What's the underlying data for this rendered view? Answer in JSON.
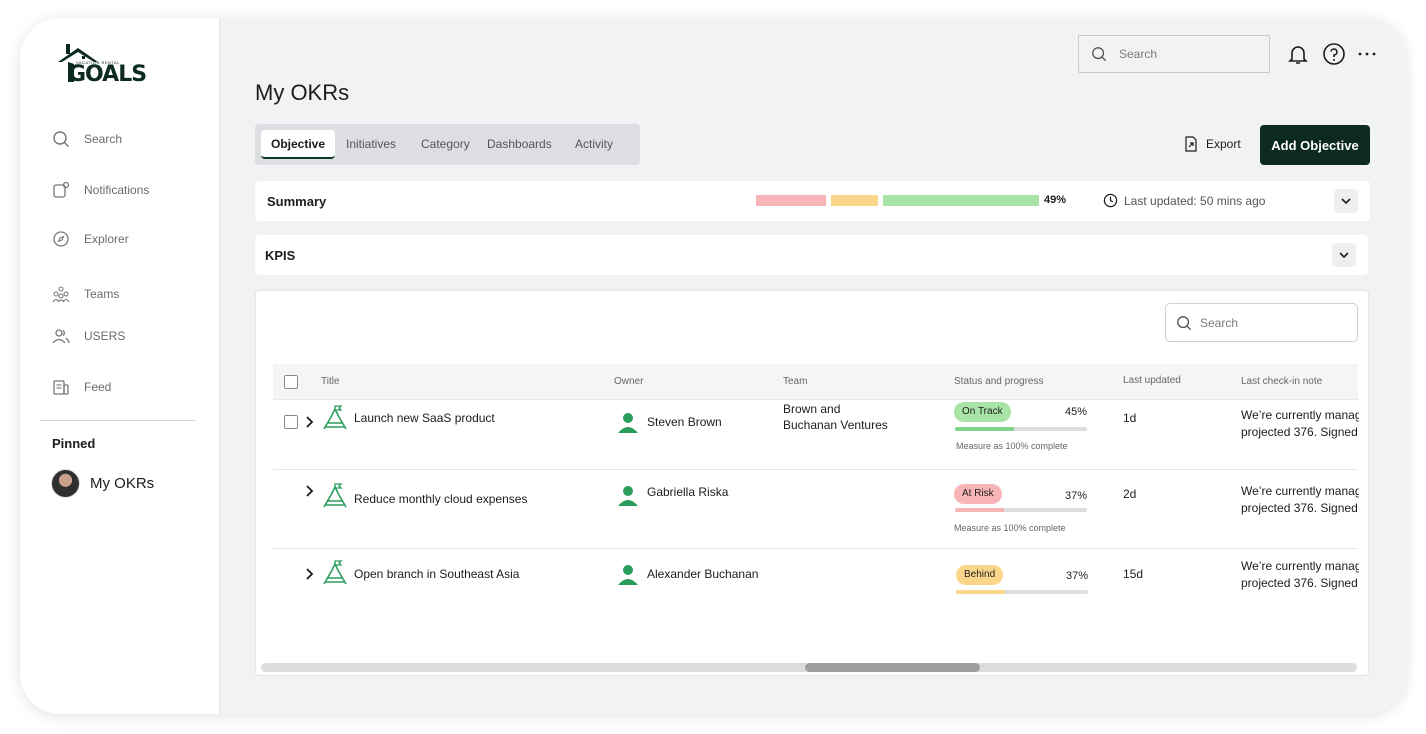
{
  "brand": {
    "name": "GOALS",
    "tagline": "VACATION RENTAL",
    "accent": "#0c2a1d",
    "icon_green": "#2a9d5c"
  },
  "sidebar": {
    "items": [
      {
        "label": "Search",
        "icon": "search-icon"
      },
      {
        "label": "Notifications",
        "icon": "notification-icon"
      },
      {
        "label": "Explorer",
        "icon": "compass-icon"
      },
      {
        "label": "Teams",
        "icon": "teams-icon"
      },
      {
        "label": "USERS",
        "icon": "users-icon"
      },
      {
        "label": "Feed",
        "icon": "feed-icon"
      }
    ],
    "pinned_label": "Pinned",
    "pinned_item": "My OKRs"
  },
  "topbar": {
    "search_placeholder": "Search"
  },
  "page": {
    "title": "My OKRs"
  },
  "tabs": [
    "Objective",
    "Initiatives",
    "Category",
    "Dashboards",
    "Activity"
  ],
  "actions": {
    "export_label": "Export",
    "add_label": "Add Objective"
  },
  "summary": {
    "title": "Summary",
    "percent": "49%",
    "last_updated": "Last updated: 50 mins ago",
    "segments": [
      {
        "color": "#f7b5b8"
      },
      {
        "color": "#fad68a"
      },
      {
        "color": "#a8e4a5"
      }
    ]
  },
  "kpis": {
    "title": "KPIS"
  },
  "table": {
    "search_placeholder": "Search",
    "headers": [
      "Title",
      "Owner",
      "Team",
      "Status and progress",
      "Last updated",
      "Last check-in note"
    ],
    "rows": [
      {
        "title": "Launch new SaaS product",
        "owner": "Steven Brown",
        "team_line1": "Brown  and",
        "team_line2": "Buchanan Ventures",
        "status": "On Track",
        "status_color": "#a8e4a5",
        "progress": 45,
        "progress_label": "45%",
        "progress_color": "#7fd48a",
        "measure": "Measure as 100% complete",
        "last_updated": "1d",
        "note_line1": "We’re currently managing",
        "note_line2": "projected 376. Signed"
      },
      {
        "title": "Reduce monthly cloud expenses",
        "owner": "Gabriella Riska",
        "team_line1": "",
        "team_line2": "",
        "status": "At Risk",
        "status_color": "#f7b5b8",
        "progress": 37,
        "progress_label": "37%",
        "progress_color": "#f7b5b8",
        "measure": "Measure as 100% complete",
        "last_updated": "2d",
        "note_line1": "We’re currently managing",
        "note_line2": "projected 376. Signed"
      },
      {
        "title": "Open branch in Southeast Asia",
        "owner": "Alexander Buchanan",
        "team_line1": "",
        "team_line2": "",
        "status": "Behind",
        "status_color": "#fad68a",
        "progress": 37,
        "progress_label": "37%",
        "progress_color": "#fad68a",
        "measure": "",
        "last_updated": "15d",
        "note_line1": "We’re currently managing",
        "note_line2": "projected 376. Signed"
      }
    ]
  }
}
